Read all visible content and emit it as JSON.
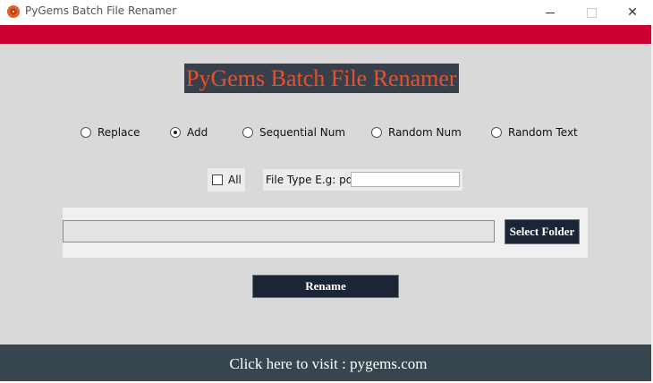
{
  "window": {
    "title": "PyGems Batch File Renamer",
    "icon": "pygems-logo-icon",
    "controls": [
      "minimize-icon",
      "maximize-icon",
      "close-icon"
    ],
    "close_glyph": "✕"
  },
  "colors": {
    "accent_strip": "#cc0033",
    "body_bg": "#d9d9d9",
    "heading_bg": "#37404a",
    "heading_fg": "#e8502a",
    "button_bg": "#1c2535",
    "footer_bg": "#37454e"
  },
  "heading": "PyGems Batch File Renamer",
  "modes": [
    {
      "label": "Replace",
      "selected": false
    },
    {
      "label": "Add",
      "selected": true
    },
    {
      "label": "Sequential Num",
      "selected": false
    },
    {
      "label": "Random Num",
      "selected": false
    },
    {
      "label": "Random Text",
      "selected": false
    }
  ],
  "filter": {
    "all_label": "All",
    "all_checked": false,
    "file_type_label": "File Type E.g: pdf",
    "file_type_value": ""
  },
  "folder": {
    "path_value": "",
    "select_label": "Select Folder"
  },
  "rename_label": "Rename",
  "footer": {
    "link_text": "Click here to visit : pygems.com"
  }
}
